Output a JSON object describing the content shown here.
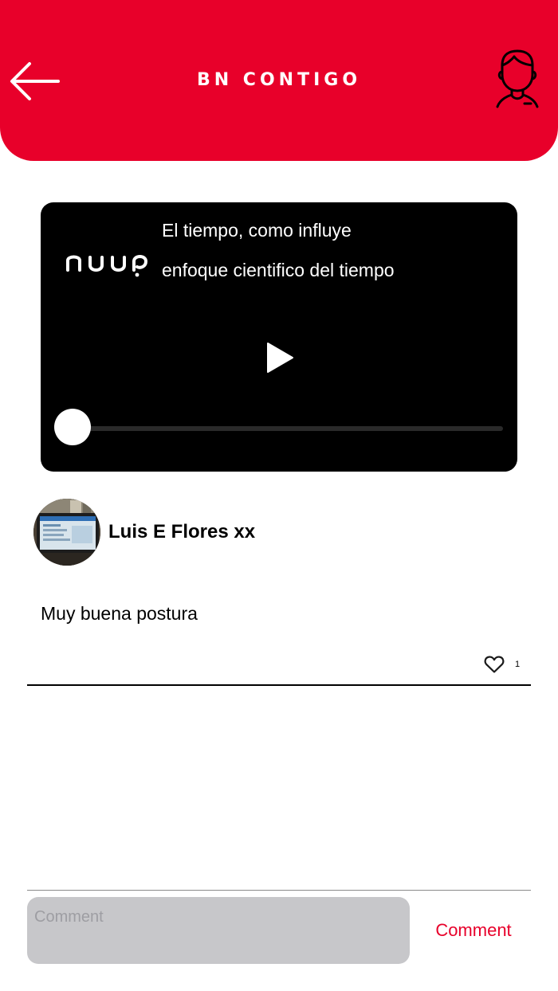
{
  "header": {
    "title": "BN CONTIGO",
    "background_color": "#E8002A",
    "back_icon": "arrow-left-icon",
    "profile_icon": "user-profile-icon"
  },
  "video": {
    "logo_text": "nuup",
    "title": "El tiempo, como influye",
    "subtitle": "enfoque cientifico del tiempo",
    "play_icon": "play-icon",
    "progress": 0
  },
  "post": {
    "author": "Luis E Flores xx",
    "text": "Muy buena postura",
    "likes": "1",
    "like_icon": "heart-outline-icon"
  },
  "composer": {
    "placeholder": "Comment",
    "submit_label": "Comment",
    "accent_color": "#E8002A"
  }
}
